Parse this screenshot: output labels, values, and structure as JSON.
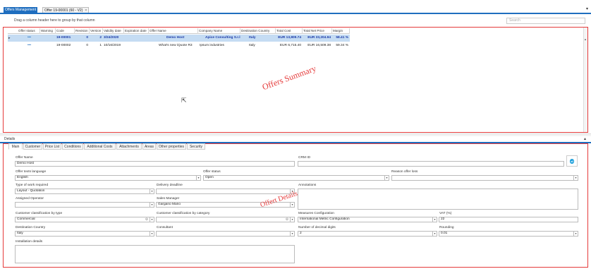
{
  "tabs": [
    {
      "label": "Offers Management",
      "active": true
    },
    {
      "label": "Offer 19-00001 (60 - V2)",
      "active": false,
      "close": "×"
    }
  ],
  "top_dropdown": "▾",
  "grouping_hint": "Drag a column header here to group by that column",
  "search_placeholder": "Search",
  "grid": {
    "columns": [
      "Offer status",
      "Warning",
      "Code",
      "Revision",
      "Version",
      "Validity date",
      "Expiration date",
      "Offer Name",
      "Company Name",
      "Destination Country",
      "Total Cost",
      "Total Net Price",
      "Margin"
    ],
    "rows": [
      {
        "marker": "▸",
        "status": "•••",
        "warning": "",
        "code": "19-00001",
        "revision": "0",
        "version": "2",
        "validity": "3/24/2020",
        "expiration": "",
        "offer_name": "Demo Host",
        "company": "Apice Consulting S.r.l.",
        "country": "Italy",
        "total_cost": "EUR 13,809.74",
        "net_price": "EUR 33,204.94",
        "margin": "58.41 %"
      },
      {
        "marker": "",
        "status": "•••",
        "warning": "",
        "code": "19-00002",
        "revision": "0",
        "version": "1",
        "validity": "10/16/2019",
        "expiration": "",
        "offer_name": "What's new iQuote R3",
        "company": "Ipsum industries",
        "country": "Italy",
        "total_cost": "EUR 6,715.40",
        "net_price": "EUR 16,509.38",
        "margin": "59.34 %"
      }
    ]
  },
  "annotations": {
    "summary": "Offers Summary",
    "details": "Offert Details"
  },
  "details": {
    "header": "Details",
    "tabs": [
      "Main",
      "Customer",
      "Price List",
      "Conditions",
      "Additional Costs",
      "Attachments",
      "Areas",
      "Other properties",
      "Security"
    ],
    "fields": {
      "offer_name_label": "Offer Name",
      "offer_name_value": "Demo Host",
      "crm_label": "CRM ID",
      "crm_value": "",
      "lang_label": "Offer texts language",
      "lang_value": "English",
      "status_label": "Offer status",
      "status_value": "Open",
      "reason_label": "Reason offer loss",
      "reason_value": "",
      "work_label": "Type of work required",
      "work_value": "Layout - Quotation",
      "deadline_label": "Delivery deadline",
      "deadline_value": "",
      "annotations_label": "Annotations",
      "operator_label": "Assigned Operator",
      "operator_value": "",
      "sales_label": "Sales Manager",
      "sales_value": "Gargano Mario",
      "class_type_label": "Customer classification by type",
      "class_type_value": "Commercial",
      "class_cat_label": "Customer classification by category",
      "class_cat_value": "",
      "measures_label": "Measures Configuration",
      "measures_value": "International Metric Configuration",
      "vat_label": "VAT (%)",
      "vat_value": "22",
      "dest_label": "Destination Country",
      "dest_value": "Italy",
      "consultant_label": "Consultant",
      "consultant_value": "",
      "decimals_label": "Number of decimal digits",
      "decimals_value": "2",
      "rounding_label": "Rounding",
      "rounding_value": "0.01",
      "install_label": "Installation details"
    }
  },
  "icons": {
    "dropdown": "chevron-down-icon",
    "gear": "gear-icon",
    "salesforce": "salesforce-icon"
  }
}
